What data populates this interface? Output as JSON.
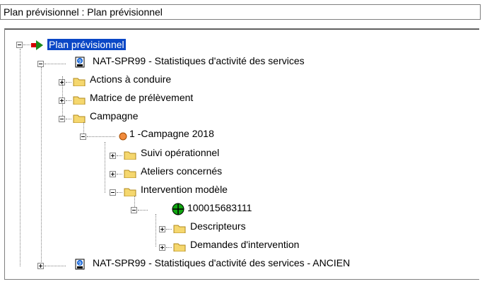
{
  "window": {
    "title": "Plan prévisionnel : Plan prévisionnel"
  },
  "tree": {
    "nodes": [
      {
        "label": "Plan prévisionnel",
        "icon": "green-arrow-icon",
        "expanded": true,
        "selected": true
      },
      {
        "label": "NAT-SPR99 - Statistiques d'activité des services",
        "icon": "report-icon",
        "expanded": true
      },
      {
        "label": "Actions à conduire",
        "icon": "folder-icon",
        "expanded": false
      },
      {
        "label": "Matrice de prélèvement",
        "icon": "folder-icon",
        "expanded": false
      },
      {
        "label": "Campagne",
        "icon": "folder-icon",
        "expanded": true
      },
      {
        "label": "1 -Campagne 2018",
        "icon": "orange-dot-icon",
        "expanded": true
      },
      {
        "label": "Suivi opérationnel",
        "icon": "folder-icon",
        "expanded": false
      },
      {
        "label": "Ateliers concernés",
        "icon": "folder-icon",
        "expanded": false
      },
      {
        "label": "Intervention modèle",
        "icon": "folder-icon",
        "expanded": true
      },
      {
        "label": "100015683111",
        "icon": "green-crosshair-icon",
        "expanded": true
      },
      {
        "label": "Descripteurs",
        "icon": "folder-icon",
        "expanded": false
      },
      {
        "label": "Demandes d'intervention",
        "icon": "folder-icon",
        "expanded": false
      },
      {
        "label": "NAT-SPR99 - Statistiques d'activité des services - ANCIEN",
        "icon": "report-icon",
        "expanded": false
      }
    ]
  }
}
